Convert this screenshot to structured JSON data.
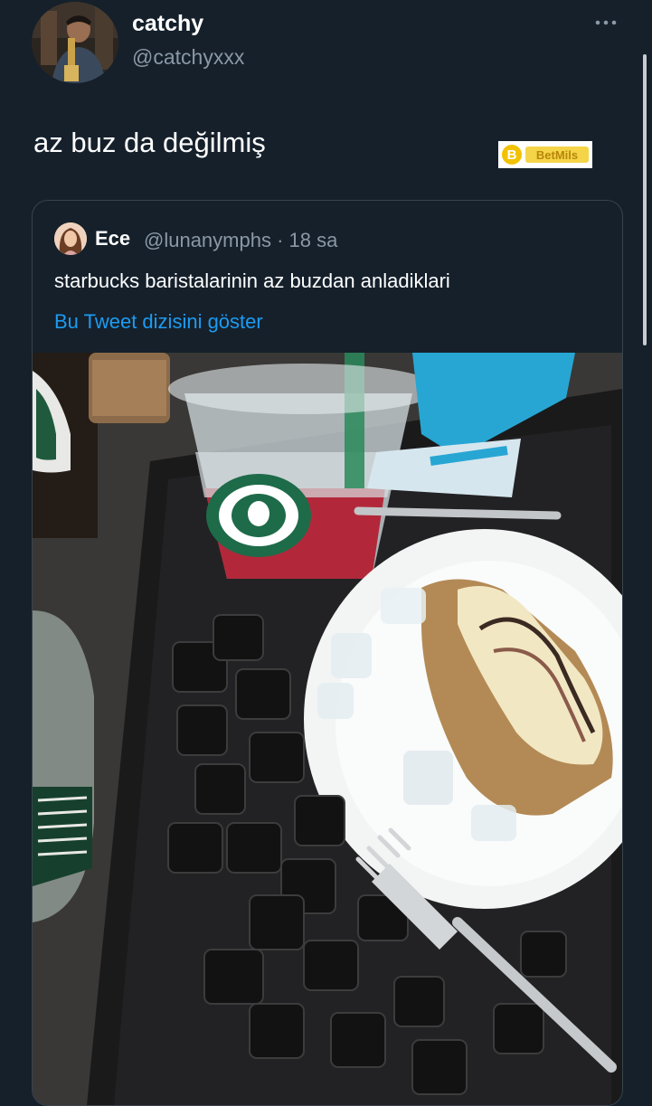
{
  "tweet": {
    "display_name": "catchy",
    "handle": "@catchyxxx",
    "text": "az buz da değilmiş"
  },
  "watermark": {
    "logo_text": "BetMils"
  },
  "quoted_tweet": {
    "display_name": "Ece",
    "handle_time": "@lunanymphs · 18 sa",
    "text": "starbucks baristalarinin az buzdan anladiklari",
    "show_thread_link": "Bu Tweet dizisini göster",
    "photo_description_icon": "photo"
  },
  "colors": {
    "background": "#15202b",
    "secondary_text": "#8b98a5",
    "link": "#1d9bf0",
    "card_border": "#38444d"
  },
  "icons": {
    "more": "more-horizontal-icon"
  }
}
